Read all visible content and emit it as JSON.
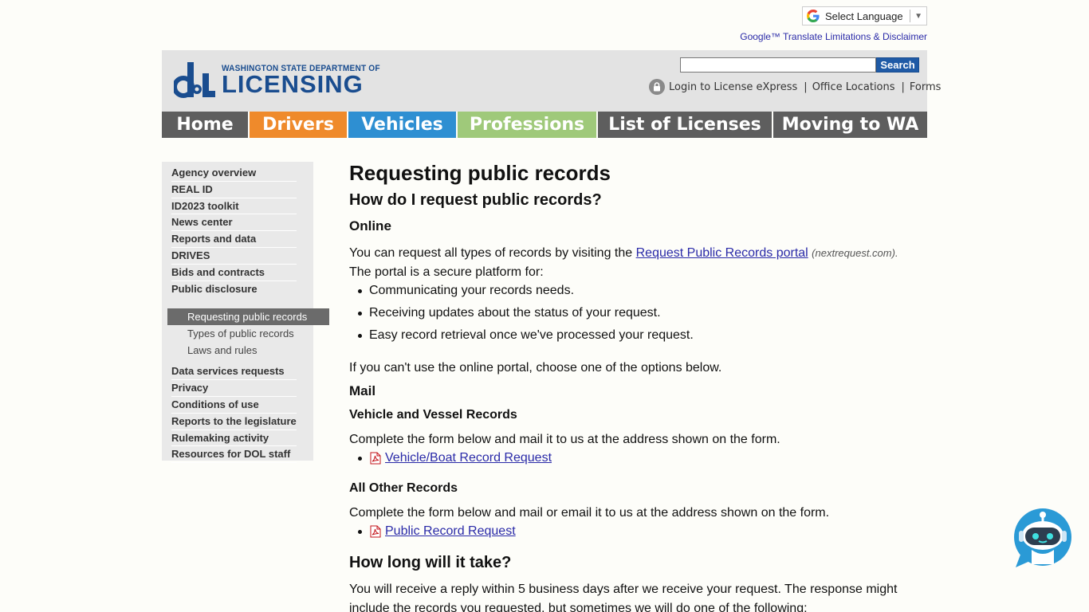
{
  "translate": {
    "select_label": "Select Language",
    "limitations_link": "Google™ Translate Limitations & Disclaimer"
  },
  "header": {
    "logo_small": "WASHINGTON STATE DEPARTMENT OF",
    "logo_big": "LICENSING",
    "search_button": "Search",
    "search_placeholder": "",
    "login_link": "Login to License eXpress",
    "office_link": "Office Locations",
    "forms_link": "Forms"
  },
  "nav": [
    {
      "label": "Home",
      "color": "#5e5e5e"
    },
    {
      "label": "Drivers",
      "color": "#ef8a2b"
    },
    {
      "label": "Vehicles",
      "color": "#2e8fd2"
    },
    {
      "label": "Professions",
      "color": "#9fc97a"
    },
    {
      "label": "List of Licenses",
      "color": "#5e5e5e"
    },
    {
      "label": "Moving to WA",
      "color": "#5e5e5e"
    }
  ],
  "sidebar": {
    "items_top": [
      "Agency overview",
      "REAL ID",
      "ID2023 toolkit",
      "News center",
      "Reports and data",
      "DRIVES",
      "Bids and contracts",
      "Public disclosure"
    ],
    "subitems": [
      "Requesting public records",
      "Types of public records",
      "Laws and rules"
    ],
    "items_bottom": [
      "Data services requests",
      "Privacy",
      "Conditions of use",
      "Reports to the legislature",
      "Rulemaking activity",
      "Resources for DOL staff"
    ]
  },
  "main": {
    "title": "Requesting public records",
    "q1": "How do I request public records?",
    "online_heading": "Online",
    "online_text_pre": "You can request all types of records by visiting the ",
    "portal_link": "Request Public Records portal",
    "portal_note": "(nextrequest.com)",
    "portal_note_end": ".",
    "portal_intro": "The portal is a secure platform for:",
    "portal_bullets": [
      "Communicating your records needs.",
      "Receiving updates about the status of your request.",
      "Easy record retrieval once we've processed your request."
    ],
    "fallback_text": "If you can't use the online portal, choose one of the options below.",
    "mail_heading": "Mail",
    "vehicle_heading": "Vehicle and Vessel Records",
    "vehicle_text": "Complete the form below and mail it to us at the address shown on the form.",
    "vehicle_link": "Vehicle/Boat Record Request",
    "other_heading": "All Other Records",
    "other_text": "Complete the form below and mail or email it to us at the address shown on the form.",
    "other_link": "Public Record Request",
    "q2": "How long will it take?",
    "reply_line1": "You will receive a reply within 5 business days after we receive your request. The response might",
    "reply_line2": "include the records you requested, but sometimes we will do one of the following:"
  },
  "colors": {
    "brand_blue": "#1a4d8f",
    "link": "#2a2aa8",
    "active_sidebar": "#6b6b6b"
  }
}
